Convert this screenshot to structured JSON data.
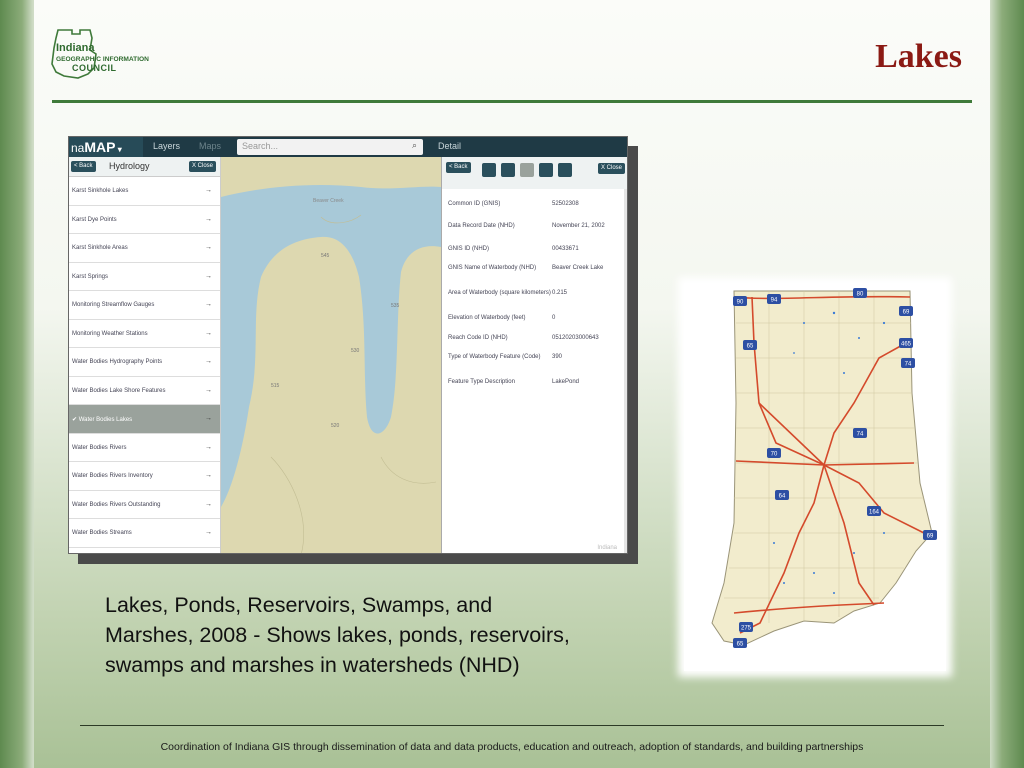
{
  "slide": {
    "title": "Lakes",
    "logo_text": [
      "Indiana",
      "GEOGRAPHIC INFORMATION",
      "COUNCIL"
    ],
    "caption": "Lakes, Ponds, Reservoirs, Swamps, and Marshes, 2008 - Shows lakes, ponds, reservoirs, swamps and marshes in watersheds (NHD)",
    "footer": "Coordination of Indiana GIS through dissemination of data and data products, education and outreach, adoption of standards, and building partnerships",
    "colors": {
      "title": "#8b1a14",
      "rule": "#3f7a3a",
      "app_bar": "#1f3a45"
    }
  },
  "app": {
    "brand_prefix": "na",
    "brand": "MAP",
    "tabs": [
      "Layers",
      "Maps"
    ],
    "search_placeholder": "Search...",
    "detail_tab": "Detail",
    "back_label": "< Back",
    "close_label": "X Close",
    "panel_title": "Hydrology",
    "layers": [
      "Karst Sinkhole Lakes",
      "Karst Dye Points",
      "Karst Sinkhole Areas",
      "Karst Springs",
      "Monitoring Streamflow Gauges",
      "Monitoring Weather Stations",
      "Water Bodies Hydrography Points",
      "Water Bodies Lake Shore Features",
      "Water Bodies Lakes",
      "Water Bodies Rivers",
      "Water Bodies Rivers Inventory",
      "Water Bodies Rivers Outstanding",
      "Water Bodies Streams"
    ],
    "selected_layer_index": 8,
    "details": [
      {
        "key": "Common ID (GNIS)",
        "value": "52502308"
      },
      {
        "key": "Data Record Date (NHD)",
        "value": "November 21, 2002"
      },
      {
        "key": "GNIS ID (NHD)",
        "value": "00433671"
      },
      {
        "key": "GNIS Name of Waterbody (NHD)",
        "value": "Beaver Creek Lake"
      },
      {
        "key": "Area of Waterbody (square kilometers)",
        "value": "0.215"
      },
      {
        "key": "Elevation of Waterbody (feet)",
        "value": "0"
      },
      {
        "key": "Reach Code ID (NHD)",
        "value": "05120203000643"
      },
      {
        "key": "Type of Waterbody Feature (Code)",
        "value": "390"
      },
      {
        "key": "Feature Type Description",
        "value": "LakePond"
      }
    ],
    "map_watermark": "Indiana",
    "map_labels": [
      "Beaver Creek",
      "545",
      "535",
      "515",
      "520",
      "530"
    ]
  },
  "indiana_map": {
    "route_shields": [
      "90",
      "94",
      "80",
      "65",
      "69",
      "465",
      "74",
      "70",
      "64",
      "164",
      "275",
      "65",
      "69",
      "74"
    ]
  }
}
